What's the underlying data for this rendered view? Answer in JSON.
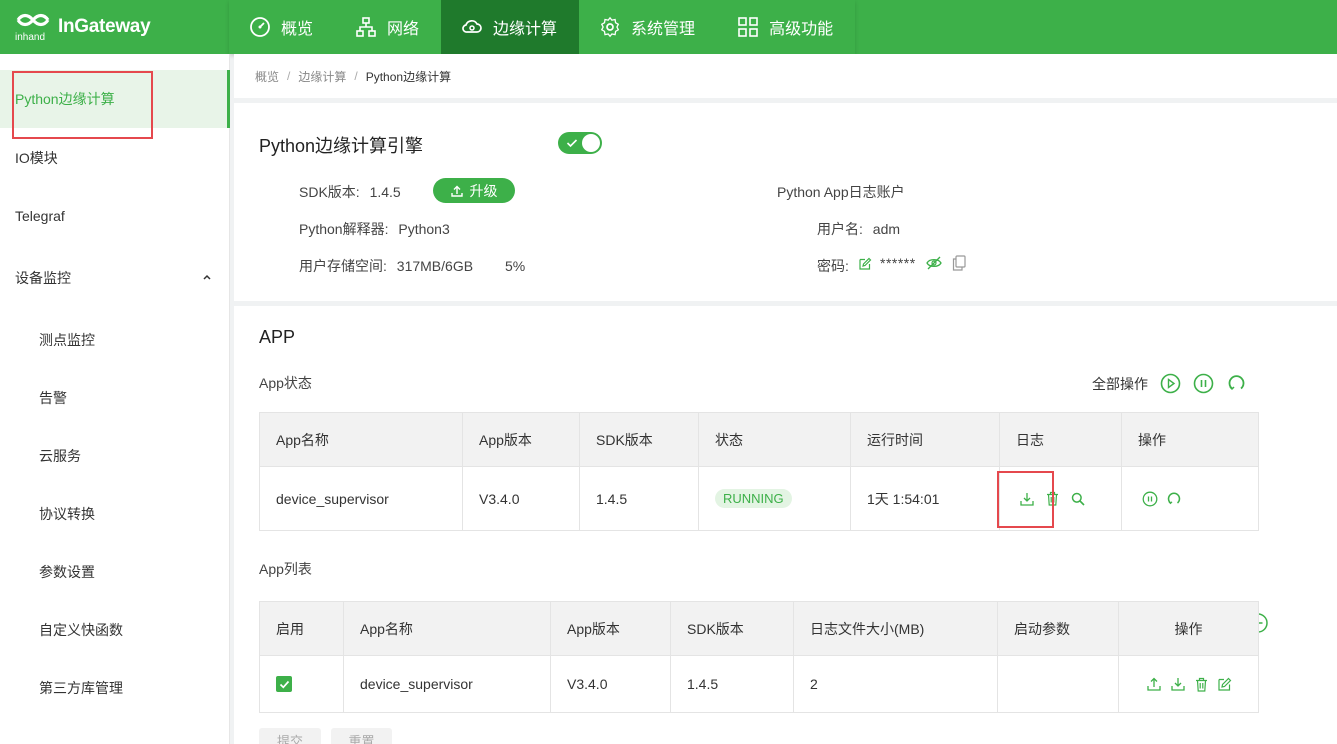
{
  "brand": {
    "name": "InGateway",
    "mark": "inhand"
  },
  "nav": {
    "items": [
      {
        "label": "概览",
        "icon": "dashboard-icon"
      },
      {
        "label": "网络",
        "icon": "network-icon"
      },
      {
        "label": "边缘计算",
        "icon": "cloud-compute-icon",
        "active": true
      },
      {
        "label": "系统管理",
        "icon": "gear-icon"
      },
      {
        "label": "高级功能",
        "icon": "grid-icon"
      }
    ]
  },
  "sidebar": {
    "items": [
      {
        "label": "Python边缘计算",
        "active": true
      },
      {
        "label": "IO模块"
      },
      {
        "label": "Telegraf"
      },
      {
        "label": "设备监控",
        "expandable": true
      },
      {
        "label": "测点监控"
      },
      {
        "label": "告警"
      },
      {
        "label": "云服务"
      },
      {
        "label": "协议转换"
      },
      {
        "label": "参数设置"
      },
      {
        "label": "自定义快函数"
      },
      {
        "label": "第三方库管理"
      }
    ]
  },
  "breadcrumb": {
    "items": [
      "概览",
      "边缘计算",
      "Python边缘计算"
    ],
    "sep": "/"
  },
  "engine": {
    "title": "Python边缘计算引擎",
    "enabled": true,
    "sdk_label": "SDK版本:",
    "sdk_value": "1.4.5",
    "upgrade_label": "升级",
    "interp_label": "Python解释器:",
    "interp_value": "Python3",
    "storage_label": "用户存储空间:",
    "storage_value": "317MB/6GB",
    "storage_pct": "5%",
    "log_account_title": "Python App日志账户",
    "user_label": "用户名:",
    "user_value": "adm",
    "pwd_label": "密码:",
    "pwd_value": "******"
  },
  "app": {
    "title": "APP",
    "status_title": "App状态",
    "all_ops_label": "全部操作",
    "status_table": {
      "headers": [
        "App名称",
        "App版本",
        "SDK版本",
        "状态",
        "运行时间",
        "日志",
        "操作"
      ],
      "rows": [
        {
          "name": "device_supervisor",
          "version": "V3.4.0",
          "sdk": "1.4.5",
          "status": "RUNNING",
          "uptime": "1天 1:54:01"
        }
      ]
    },
    "list_title": "App列表",
    "list_table": {
      "headers": [
        "启用",
        "App名称",
        "App版本",
        "SDK版本",
        "日志文件大小(MB)",
        "启动参数",
        "操作"
      ],
      "rows": [
        {
          "enabled": true,
          "name": "device_supervisor",
          "version": "V3.4.0",
          "sdk": "1.4.5",
          "log_size": "2",
          "args": ""
        }
      ]
    },
    "submit_label": "提交",
    "reset_label": "重置"
  },
  "colors": {
    "brand_green": "#3db049",
    "nav_active": "#1f7a2c",
    "highlight_red": "#e5484d"
  }
}
